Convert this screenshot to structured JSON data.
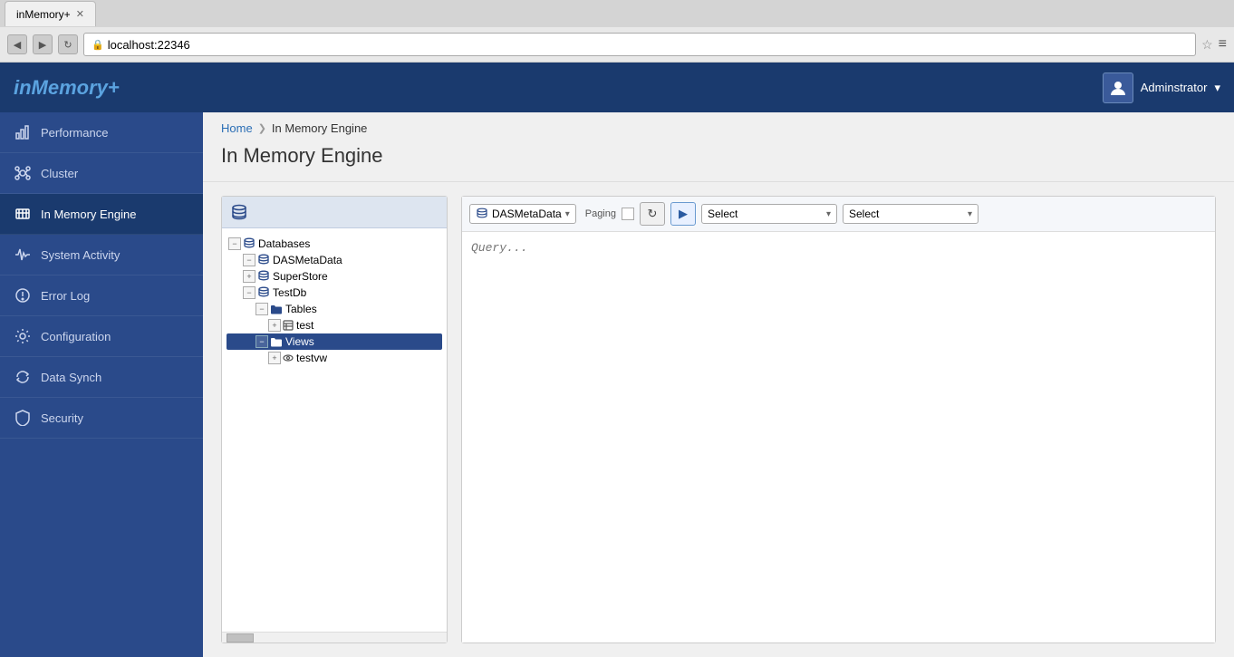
{
  "browser": {
    "tab_title": "inMemory+",
    "url": "localhost:22346"
  },
  "app": {
    "logo": "inMemory+",
    "logo_plus": "+",
    "admin_label": "Adminstrator"
  },
  "breadcrumb": {
    "home": "Home",
    "separator": "❯",
    "current": "In Memory Engine"
  },
  "page_title": "In Memory Engine",
  "sidebar": {
    "items": [
      {
        "id": "performance",
        "label": "Performance",
        "icon": "chart-icon"
      },
      {
        "id": "cluster",
        "label": "Cluster",
        "icon": "cluster-icon"
      },
      {
        "id": "in-memory-engine",
        "label": "In Memory Engine",
        "icon": "memory-icon",
        "active": true
      },
      {
        "id": "system-activity",
        "label": "System Activity",
        "icon": "activity-icon"
      },
      {
        "id": "error-log",
        "label": "Error Log",
        "icon": "error-icon"
      },
      {
        "id": "configuration",
        "label": "Configuration",
        "icon": "config-icon"
      },
      {
        "id": "data-synch",
        "label": "Data Synch",
        "icon": "sync-icon"
      },
      {
        "id": "security",
        "label": "Security",
        "icon": "security-icon"
      }
    ]
  },
  "tree": {
    "header_icon": "database-icon",
    "databases_label": "Databases",
    "nodes": [
      {
        "id": "databases",
        "label": "Databases",
        "level": 0,
        "expanded": true,
        "type": "root"
      },
      {
        "id": "dasmetadata",
        "label": "DASMetaData",
        "level": 1,
        "expanded": true,
        "type": "database"
      },
      {
        "id": "superstore",
        "label": "SuperStore",
        "level": 1,
        "expanded": false,
        "type": "database"
      },
      {
        "id": "testdb",
        "label": "TestDb",
        "level": 1,
        "expanded": true,
        "type": "database"
      },
      {
        "id": "tables",
        "label": "Tables",
        "level": 2,
        "expanded": true,
        "type": "folder"
      },
      {
        "id": "test",
        "label": "test",
        "level": 3,
        "expanded": false,
        "type": "table"
      },
      {
        "id": "views",
        "label": "Views",
        "level": 2,
        "expanded": true,
        "type": "folder",
        "selected": true
      },
      {
        "id": "testvw",
        "label": "testvw",
        "level": 3,
        "expanded": false,
        "type": "view"
      }
    ]
  },
  "query_toolbar": {
    "db_label": "DASMetaData",
    "paging_label": "Paging",
    "select1_label": "Select",
    "select2_label": "Select",
    "query_placeholder": "Query..."
  }
}
